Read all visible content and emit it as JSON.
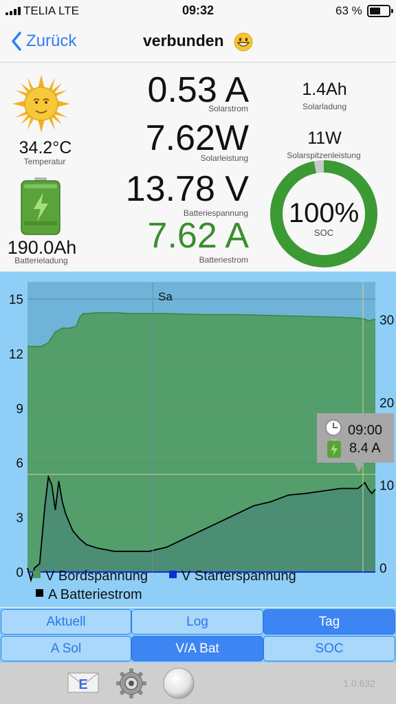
{
  "status": {
    "carrier": "TELIA  LTE",
    "time": "09:32",
    "battery": "63 %"
  },
  "nav": {
    "back_label": "Zurück",
    "title": "verbunden"
  },
  "dashboard": {
    "temperature": {
      "value": "34.2°C",
      "label": "Temperatur"
    },
    "battery_charge": {
      "value": "190.0Ah",
      "label": "Batterieladung"
    },
    "solar_current": {
      "value": "0.53 A",
      "label": "Solarstrom"
    },
    "solar_power": {
      "value": "7.62W",
      "label": "Solarleistung"
    },
    "battery_voltage": {
      "value": "13.78 V",
      "label": "Batteriespannung"
    },
    "battery_current": {
      "value": "7.62 A",
      "label": "Batteriestrom"
    },
    "solar_charge": {
      "value": "1.4Ah",
      "label": "Solarladung"
    },
    "solar_peak": {
      "value": "11W",
      "label": "Solarspitzenleistung"
    },
    "soc": {
      "value": "100%",
      "label": "SOC",
      "fraction": 0.97
    }
  },
  "chart": {
    "day_label": "Sa",
    "tooltip": {
      "time": "09:00",
      "value": "8.4 A"
    },
    "legend": [
      "V Bordspannung",
      "V Starterspannung",
      "A Batteriestrom"
    ]
  },
  "chart_data": {
    "type": "area",
    "title": "",
    "xlabel": "",
    "ylabel": "",
    "ylim": [
      0,
      15
    ],
    "yticks": [
      "15",
      "12",
      "9",
      "6",
      "3",
      "0"
    ],
    "y2ticks": [
      "30",
      "20",
      "10",
      "0"
    ],
    "y2lim": [
      -0.5,
      30
    ],
    "colors": {
      "bord": "#4f9a58",
      "starter": "#0b2fd0",
      "strom": "#000000"
    },
    "series": [
      {
        "name": "V Bordspannung",
        "x": [
          0.0,
          0.04,
          0.06,
          0.08,
          0.1,
          0.12,
          0.14,
          0.15,
          0.16,
          0.17,
          0.2,
          0.25,
          0.3,
          0.35,
          0.4,
          0.5,
          0.6,
          0.7,
          0.8,
          0.9,
          0.95,
          0.97,
          0.98,
          1.0
        ],
        "y": [
          12.4,
          12.4,
          12.6,
          13.2,
          13.4,
          13.4,
          13.5,
          14.0,
          14.2,
          14.2,
          14.25,
          14.25,
          14.2,
          14.2,
          14.2,
          14.15,
          14.15,
          14.1,
          14.05,
          14.0,
          13.95,
          13.9,
          13.8,
          13.9
        ]
      },
      {
        "name": "V Starterspannung",
        "x": [
          0.0,
          1.0
        ],
        "y": [
          0.0,
          0.0
        ]
      },
      {
        "name": "A Batteriestrom",
        "axis": "right",
        "x": [
          0.0,
          0.01,
          0.02,
          0.035,
          0.05,
          0.06,
          0.07,
          0.08,
          0.09,
          0.1,
          0.11,
          0.12,
          0.13,
          0.15,
          0.17,
          0.2,
          0.25,
          0.3,
          0.35,
          0.4,
          0.45,
          0.5,
          0.55,
          0.6,
          0.65,
          0.7,
          0.75,
          0.8,
          0.85,
          0.9,
          0.95,
          0.97,
          0.98,
          0.99,
          1.0
        ],
        "y": [
          0.0,
          -1.5,
          0.0,
          0.5,
          7.5,
          11.0,
          10.0,
          7.0,
          10.5,
          8.0,
          6.5,
          5.5,
          4.5,
          3.5,
          2.8,
          2.4,
          2.0,
          2.0,
          2.0,
          2.5,
          3.5,
          4.5,
          5.5,
          6.5,
          7.5,
          8.0,
          8.8,
          9.0,
          9.3,
          9.6,
          9.6,
          10.3,
          9.5,
          9.0,
          9.5
        ]
      }
    ]
  },
  "tabs": {
    "row1": [
      {
        "label": "Aktuell"
      },
      {
        "label": "Log"
      },
      {
        "label": "Tag"
      }
    ],
    "row2": [
      {
        "label": "A Sol"
      },
      {
        "label": "V/A Bat"
      },
      {
        "label": "SOC"
      }
    ]
  },
  "toolbar": {
    "version": "1.0.632",
    "mail_icon_letter": "E"
  },
  "icons": {
    "sun": "sun-face-icon",
    "battery": "battery-charging-icon",
    "emoji": "grinning-face-icon"
  }
}
